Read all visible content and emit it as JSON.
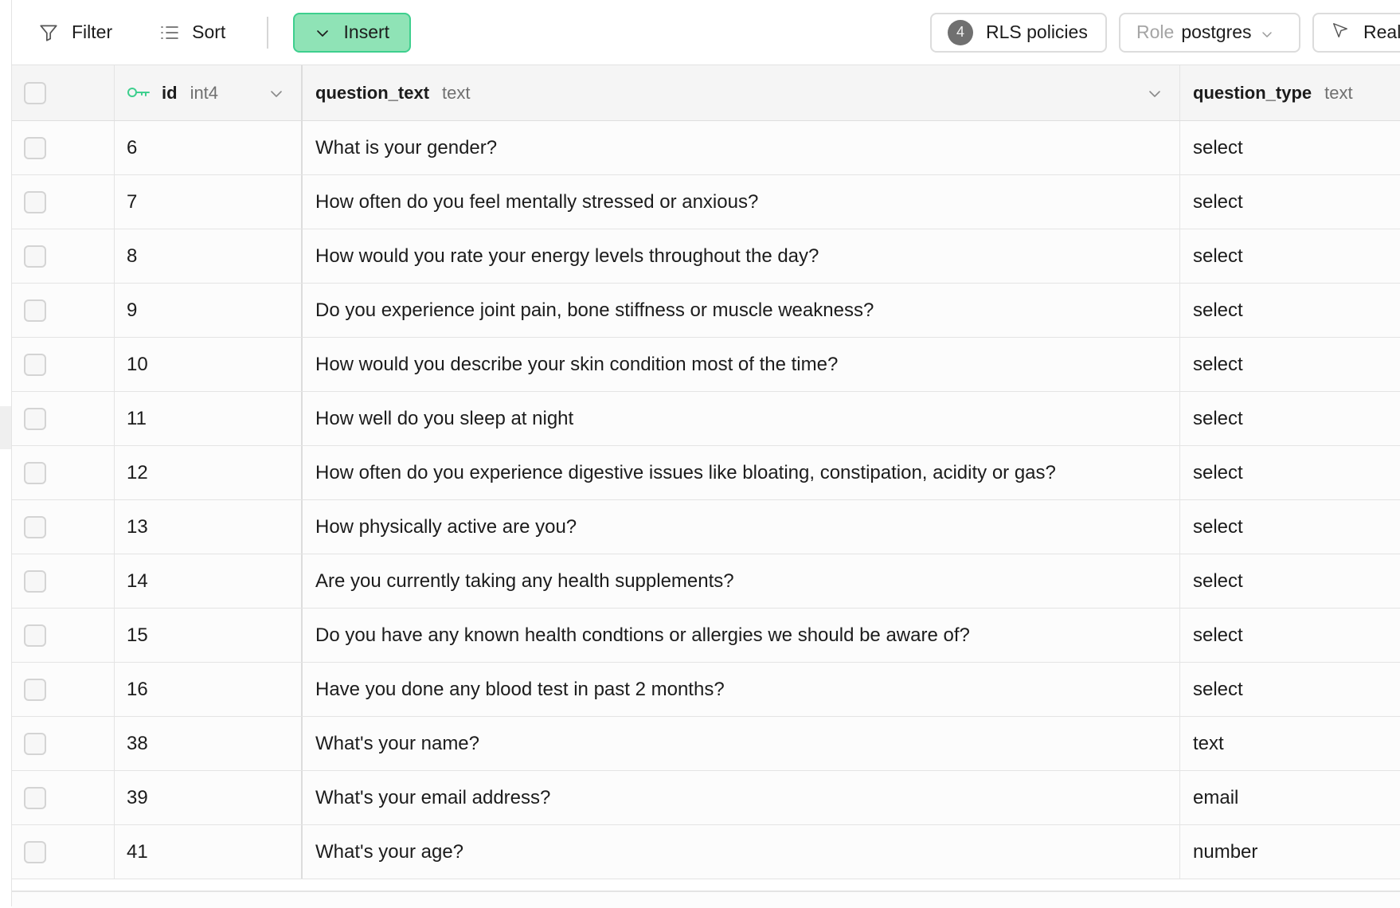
{
  "toolbar": {
    "filter_label": "Filter",
    "sort_label": "Sort",
    "insert_label": "Insert",
    "rls_count": "4",
    "rls_label": "RLS policies",
    "role_label": "Role",
    "role_value": "postgres",
    "realtime_label": "Realt",
    "insert_bg": "#8fe3b6",
    "insert_border": "#3ecf8e"
  },
  "columns": [
    {
      "name": "id",
      "type": "int4",
      "primary_key": true
    },
    {
      "name": "question_text",
      "type": "text"
    },
    {
      "name": "question_type",
      "type": "text"
    }
  ],
  "rows": [
    {
      "id": "6",
      "question_text": "What is your gender?",
      "question_type": "select"
    },
    {
      "id": "7",
      "question_text": "How often do you feel mentally stressed or anxious?",
      "question_type": "select"
    },
    {
      "id": "8",
      "question_text": "How would you rate your energy levels throughout the day?",
      "question_type": "select"
    },
    {
      "id": "9",
      "question_text": "Do you experience joint pain, bone stiffness or muscle weakness?",
      "question_type": "select"
    },
    {
      "id": "10",
      "question_text": "How would you describe your skin condition most of the time?",
      "question_type": "select"
    },
    {
      "id": "11",
      "question_text": "How well do you sleep at night",
      "question_type": "select"
    },
    {
      "id": "12",
      "question_text": "How often do you experience digestive issues like bloating, constipation, acidity or gas?",
      "question_type": "select"
    },
    {
      "id": "13",
      "question_text": "How physically active are you?",
      "question_type": "select"
    },
    {
      "id": "14",
      "question_text": "Are you currently taking any health supplements?",
      "question_type": "select"
    },
    {
      "id": "15",
      "question_text": "Do you have any known health condtions or allergies we should be aware of?",
      "question_type": "select"
    },
    {
      "id": "16",
      "question_text": "Have you done any blood test in past 2 months?",
      "question_type": "select"
    },
    {
      "id": "38",
      "question_text": "What's your name?",
      "question_type": "text"
    },
    {
      "id": "39",
      "question_text": "What's your email address?",
      "question_type": "email"
    },
    {
      "id": "41",
      "question_text": "What's your age?",
      "question_type": "number"
    }
  ]
}
